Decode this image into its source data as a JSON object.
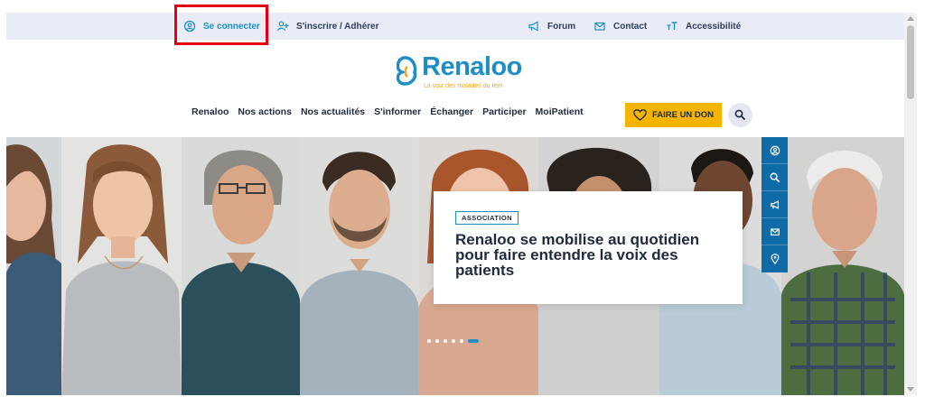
{
  "topbar": {
    "login_label": "Se connecter",
    "register_label": "S'inscrire / Adhérer",
    "forum_label": "Forum",
    "contact_label": "Contact",
    "accessibility_label": "Accessibilité"
  },
  "logo": {
    "name": "Renaloo",
    "tagline": "La voix des malades du rein"
  },
  "nav": {
    "items": [
      "Renaloo",
      "Nos actions",
      "Nos actualités",
      "S'informer",
      "Échanger",
      "Participer",
      "MoiPatient"
    ],
    "donate_label": "FAIRE UN DON"
  },
  "hero": {
    "badge": "ASSOCIATION",
    "headline": "Renaloo se mobilise au quotidien pour faire entendre la voix des patients",
    "slides_count": 6,
    "active_slide": 6
  },
  "colors": {
    "brand_blue": "#1d8fc4",
    "donate_yellow": "#f5b400",
    "side_blue": "#0f6aa8"
  },
  "icons": {
    "login": "user-circle-icon",
    "register": "add-user-icon",
    "forum": "megaphone-icon",
    "contact": "envelope-icon",
    "accessibility": "text-size-icon",
    "donate": "heart-icon",
    "search": "search-icon",
    "side": [
      "user-circle-icon",
      "search-icon",
      "megaphone-icon",
      "envelope-icon",
      "location-pin-icon"
    ]
  }
}
